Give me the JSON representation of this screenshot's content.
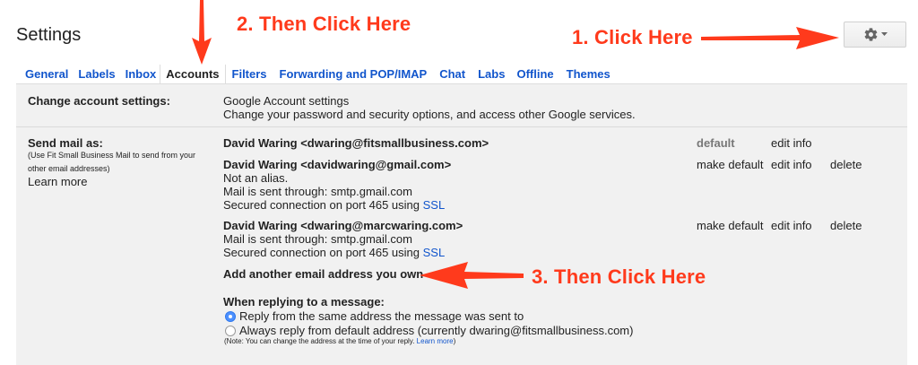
{
  "header": {
    "title": "Settings"
  },
  "tabs": [
    {
      "label": "General",
      "active": false
    },
    {
      "label": "Labels",
      "active": false
    },
    {
      "label": "Inbox",
      "active": false
    },
    {
      "label": "Accounts",
      "active": true
    },
    {
      "label": "Filters",
      "active": false
    },
    {
      "label": "Forwarding and POP/IMAP",
      "active": false
    },
    {
      "label": "Chat",
      "active": false
    },
    {
      "label": "Labs",
      "active": false
    },
    {
      "label": "Offline",
      "active": false
    },
    {
      "label": "Themes",
      "active": false
    }
  ],
  "change_account": {
    "label": "Change account settings:",
    "link": "Google Account settings",
    "description": "Change your password and security options, and access other Google services."
  },
  "send_mail": {
    "label": "Send mail as:",
    "help_line1": "(Use Fit Small Business Mail to send from your",
    "help_line2": "other email addresses)",
    "learn_more": "Learn more",
    "entries": [
      {
        "address": "David Waring <dwaring@fitsmallbusiness.com>",
        "status": "default",
        "edit": "edit info"
      },
      {
        "address": "David Waring <davidwaring@gmail.com>",
        "line2": "Not an alias.",
        "line3": "Mail is sent through: smtp.gmail.com",
        "line4_prefix": "Secured connection on port 465 using",
        "ssl": "SSL",
        "make_default": "make default",
        "edit": "edit info",
        "delete": "delete"
      },
      {
        "address": "David Waring <dwaring@marcwaring.com>",
        "line2": "Mail is sent through: smtp.gmail.com",
        "line3_prefix": "Secured connection on port 465 using",
        "ssl": "SSL",
        "make_default": "make default",
        "edit": "edit info",
        "delete": "delete"
      }
    ],
    "add_link": "Add another email address you own",
    "reply_heading": "When replying to a message:",
    "reply_option1": "Reply from the same address the message was sent to",
    "reply_option2": "Always reply from default address (currently dwaring@fitsmallbusiness.com)",
    "note_text": "(Note: You can change the address at the time of your reply.",
    "note_link": "Learn more",
    "note_close": ")"
  },
  "annotations": {
    "a1": "1. Click Here",
    "a2": "2. Then Click Here",
    "a3": "3. Then Click Here",
    "color": "#ff3a1c"
  },
  "icons": {
    "settings": "gear-icon",
    "dropdown": "caret-down-icon"
  }
}
